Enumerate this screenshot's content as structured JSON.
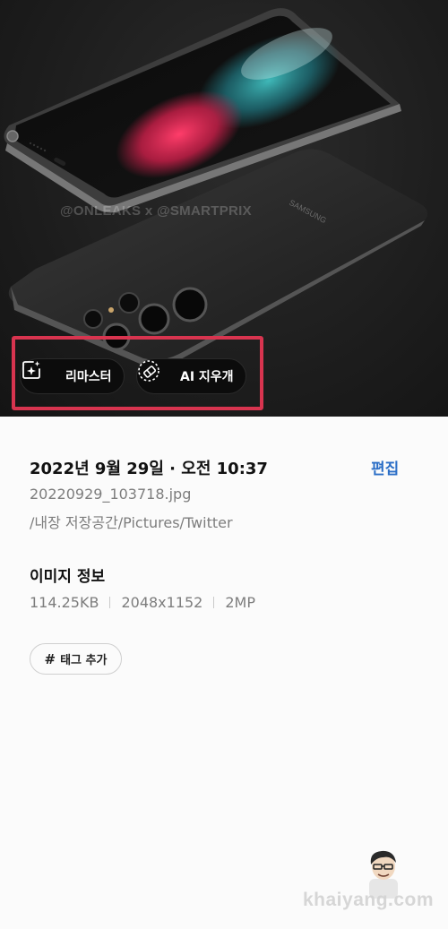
{
  "photo": {
    "watermark_credit": "@ONLEAKS x @SMARTPRIX",
    "tools": [
      {
        "label": "리마스터",
        "icon": "sparkle-frame-icon"
      },
      {
        "label": "AI 지우개",
        "icon": "eraser-icon"
      }
    ],
    "highlight_color": "#d8344f"
  },
  "details": {
    "date": "2022년 9월 29일 · 오전 10:37",
    "edit_label": "편집",
    "filename": "20220929_103718.jpg",
    "path": "/내장 저장공간/Pictures/Twitter",
    "image_info_title": "이미지 정보",
    "size": "114.25KB",
    "resolution": "2048x1152",
    "megapixels": "2MP",
    "add_tag_label": "태그 추가",
    "tag_symbol": "#"
  },
  "site_watermark": "khaiyang.com",
  "accent_color": "#2c6fc7"
}
